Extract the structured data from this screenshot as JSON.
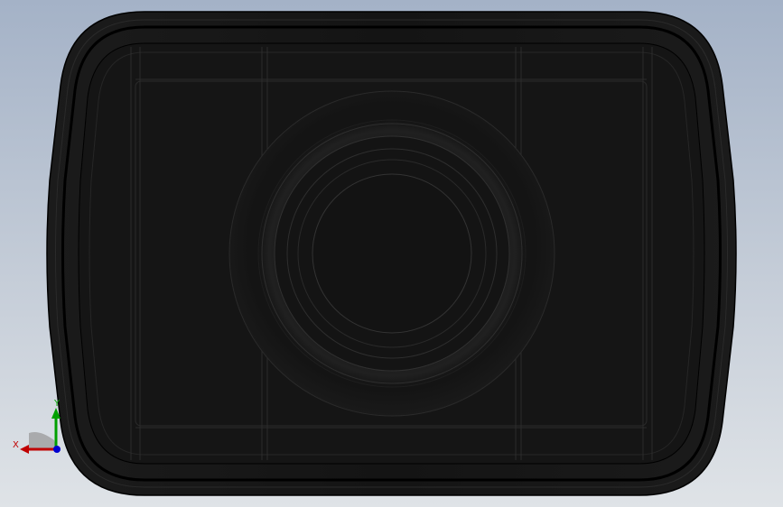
{
  "viewport": {
    "background_top": "#a4b2c7",
    "background_bottom": "#dfe3e7",
    "part_color": "#111111",
    "edge_color": "#000000"
  },
  "triad": {
    "x_label": "X",
    "y_label": "Y",
    "x_color": "#c00000",
    "y_color": "#00a000",
    "z_color": "#0000d0"
  }
}
